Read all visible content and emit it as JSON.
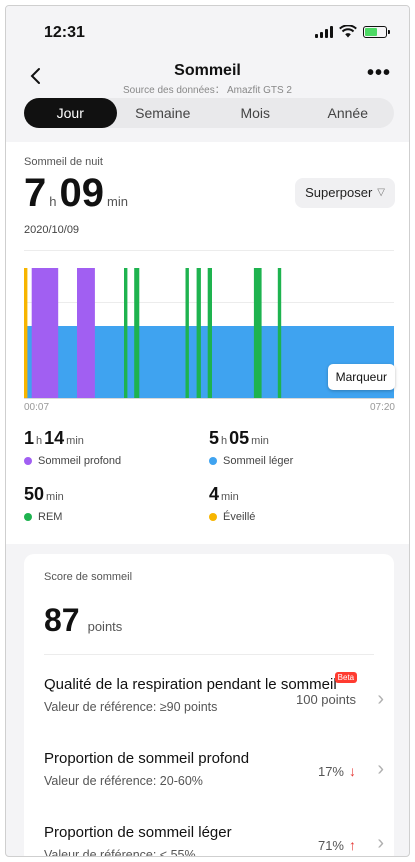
{
  "status_bar": {
    "time": "12:31"
  },
  "header": {
    "title": "Sommeil",
    "subtitle": "Source des données： Amazfit GTS 2"
  },
  "tabs": [
    {
      "label": "Jour",
      "active": true
    },
    {
      "label": "Semaine",
      "active": false
    },
    {
      "label": "Mois",
      "active": false
    },
    {
      "label": "Année",
      "active": false
    }
  ],
  "summary": {
    "label": "Sommeil de nuit",
    "hours": "7",
    "hours_unit": "h",
    "minutes": "09",
    "minutes_unit": "min",
    "date": "2020/10/09",
    "overlay_button": "Superposer"
  },
  "chart_data": {
    "type": "timeline",
    "x_start": "00:07",
    "x_end": "07:20",
    "colors": {
      "deep": "#a15ff2",
      "light": "#3fa3f0",
      "rem": "#1eb34f",
      "awake": "#f7b500"
    },
    "segments": [
      {
        "stage": "awake",
        "start": "00:07",
        "end": "00:11"
      },
      {
        "stage": "deep",
        "start": "00:16",
        "end": "00:47"
      },
      {
        "stage": "deep",
        "start": "01:09",
        "end": "01:30"
      },
      {
        "stage": "rem",
        "start": "02:04",
        "end": "02:08"
      },
      {
        "stage": "rem",
        "start": "02:16",
        "end": "02:22"
      },
      {
        "stage": "rem",
        "start": "03:16",
        "end": "03:20"
      },
      {
        "stage": "rem",
        "start": "03:29",
        "end": "03:34"
      },
      {
        "stage": "rem",
        "start": "03:42",
        "end": "03:47"
      },
      {
        "stage": "rem",
        "start": "04:36",
        "end": "04:45"
      },
      {
        "stage": "rem",
        "start": "05:04",
        "end": "05:08"
      }
    ],
    "marker_label": "Marqueur"
  },
  "stats": [
    {
      "value_a": "1",
      "unit_a": "h",
      "value_b": "14",
      "unit_b": "min",
      "label": "Sommeil profond",
      "color": "#a15ff2"
    },
    {
      "value_a": "5",
      "unit_a": "h",
      "value_b": "05",
      "unit_b": "min",
      "label": "Sommeil léger",
      "color": "#3fa3f0"
    },
    {
      "value_a": "50",
      "unit_a": "min",
      "value_b": "",
      "unit_b": "",
      "label": "REM",
      "color": "#1eb34f"
    },
    {
      "value_a": "4",
      "unit_a": "min",
      "value_b": "",
      "unit_b": "",
      "label": "Éveillé",
      "color": "#f7b500"
    }
  ],
  "score": {
    "label": "Score de sommeil",
    "value": "87",
    "unit": "points",
    "rows": [
      {
        "title": "Qualité de la respiration pendant le sommeil",
        "badge": "Beta",
        "subtitle": "Valeur de référence: ≥90 points",
        "value": "100 points",
        "arrow": ""
      },
      {
        "title": "Proportion de sommeil profond",
        "badge": "",
        "subtitle": "Valeur de référence: 20-60%",
        "value": "17%",
        "arrow": "↓"
      },
      {
        "title": "Proportion de sommeil léger",
        "badge": "",
        "subtitle": "Valeur de référence: < 55%",
        "value": "71%",
        "arrow": "↑"
      }
    ]
  }
}
